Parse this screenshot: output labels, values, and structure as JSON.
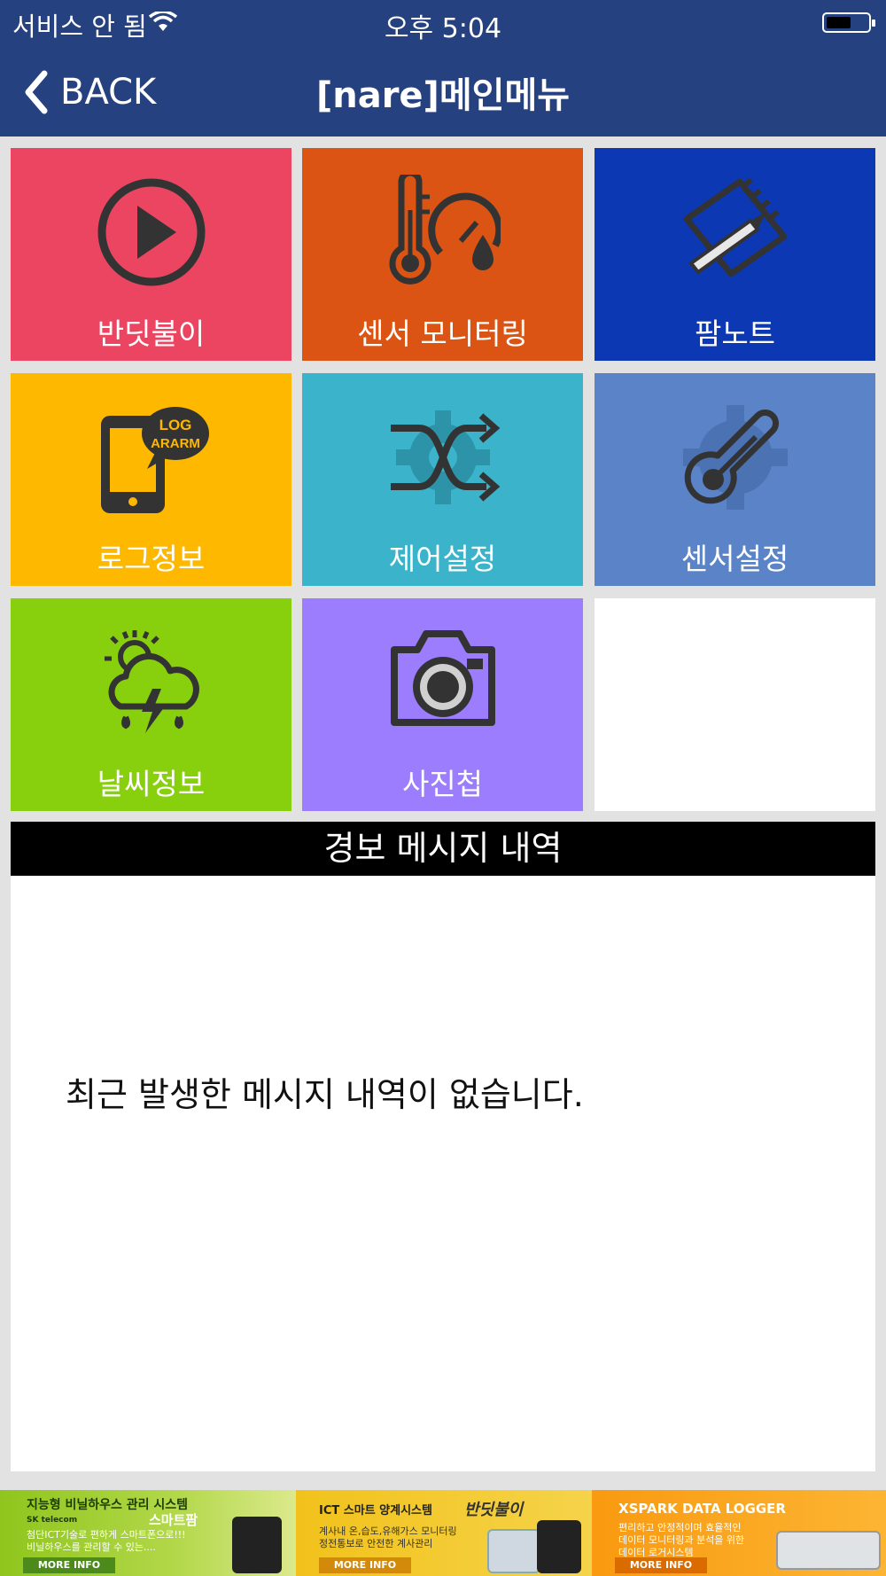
{
  "status_bar": {
    "carrier": "서비스 안 됨",
    "time": "오후 5:04"
  },
  "nav": {
    "back_label": "BACK",
    "title": "[nare]메인메뉴"
  },
  "menu": [
    {
      "label": "반딧불이",
      "icon": "play-icon",
      "color": "#ec4561"
    },
    {
      "label": "센서 모니터링",
      "icon": "thermometer-gauge-icon",
      "color": "#db5414"
    },
    {
      "label": "팜노트",
      "icon": "notebook-pencil-icon",
      "color": "#0c38b4"
    },
    {
      "label": "로그정보",
      "icon": "phone-log-icon",
      "color": "#ffb800",
      "icon_text": [
        "LOG",
        "ARARM"
      ]
    },
    {
      "label": "제어설정",
      "icon": "shuffle-gear-icon",
      "color": "#3ab3cb"
    },
    {
      "label": "센서설정",
      "icon": "thermometer-gear-icon",
      "color": "#5b84c8"
    },
    {
      "label": "날씨정보",
      "icon": "weather-storm-icon",
      "color": "#88d00e"
    },
    {
      "label": "사진첩",
      "icon": "camera-icon",
      "color": "#9b7dfe"
    }
  ],
  "alarm": {
    "header": "경보 메시지 내역",
    "empty_message": "최근 발생한 메시지 내역이 없습니다."
  },
  "ads": [
    {
      "title": "지능형 비닐하우스 관리 시스템",
      "brand": "SK telecom",
      "product": "스마트팜",
      "lines": [
        "첨단ICT기술로 편하게 스마트폰으로!!!",
        "비닐하우스를 관리할 수 있는...."
      ],
      "more": "MORE INFO",
      "color": "#8fc51d"
    },
    {
      "title": "ICT 스마트 양계시스템",
      "product": "반딧불이",
      "lines": [
        "계사내 온,습도,유해가스 모니터링",
        "정전통보로 안전한 계사관리"
      ],
      "more": "MORE INFO",
      "color": "#f2c21b"
    },
    {
      "title": "XSPARK DATA LOGGER",
      "lines": [
        "편리하고 안정적이며 효율적인",
        "데이터 모니터링과 분석을 위한",
        "데이터 로거시스템"
      ],
      "more": "MORE INFO",
      "color": "#f99a10"
    }
  ]
}
